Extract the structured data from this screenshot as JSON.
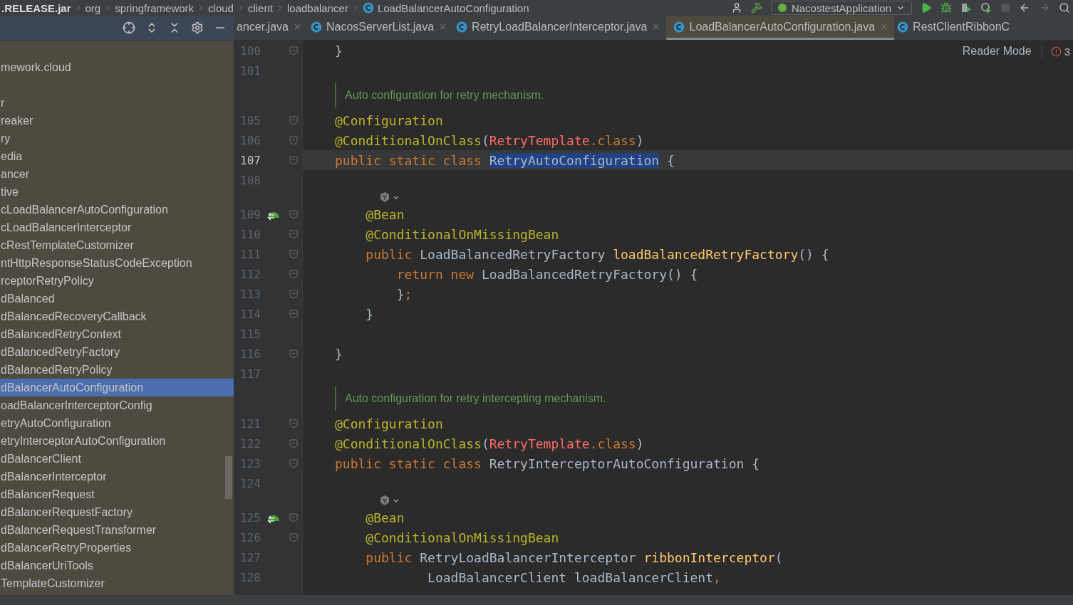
{
  "breadcrumb": [
    {
      "text": ".RELEASE.jar",
      "class_icon": false
    },
    {
      "text": "org",
      "class_icon": false
    },
    {
      "text": "springframework",
      "class_icon": false
    },
    {
      "text": "cloud",
      "class_icon": false
    },
    {
      "text": "client",
      "class_icon": false
    },
    {
      "text": "loadbalancer",
      "class_icon": false
    },
    {
      "text": "LoadBalancerAutoConfiguration",
      "class_icon": true
    }
  ],
  "toolbar": {
    "run_config": "NacostestApplication"
  },
  "project_panel": {
    "items": [
      {
        "text": "mework.cloud",
        "selected": false
      },
      {
        "text": "r",
        "selected": false
      },
      {
        "text": "reaker",
        "selected": false
      },
      {
        "text": "ry",
        "selected": false
      },
      {
        "text": "edia",
        "selected": false
      },
      {
        "text": "ancer",
        "selected": false
      },
      {
        "text": "tive",
        "selected": false
      },
      {
        "text": "cLoadBalancerAutoConfiguration",
        "selected": false
      },
      {
        "text": "cLoadBalancerInterceptor",
        "selected": false
      },
      {
        "text": "cRestTemplateCustomizer",
        "selected": false
      },
      {
        "text": "ntHttpResponseStatusCodeException",
        "selected": false
      },
      {
        "text": "rceptorRetryPolicy",
        "selected": false
      },
      {
        "text": "dBalanced",
        "selected": false
      },
      {
        "text": "dBalancedRecoveryCallback",
        "selected": false
      },
      {
        "text": "dBalancedRetryContext",
        "selected": false
      },
      {
        "text": "dBalancedRetryFactory",
        "selected": false
      },
      {
        "text": "dBalancedRetryPolicy",
        "selected": false
      },
      {
        "text": "dBalancerAutoConfiguration",
        "selected": true
      },
      {
        "text": "oadBalancerInterceptorConfig",
        "selected": false
      },
      {
        "text": "etryAutoConfiguration",
        "selected": false
      },
      {
        "text": "etryInterceptorAutoConfiguration",
        "selected": false
      },
      {
        "text": "dBalancerClient",
        "selected": false
      },
      {
        "text": "dBalancerInterceptor",
        "selected": false
      },
      {
        "text": "dBalancerRequest",
        "selected": false
      },
      {
        "text": "dBalancerRequestFactory",
        "selected": false
      },
      {
        "text": "dBalancerRequestTransformer",
        "selected": false
      },
      {
        "text": "dBalancerRetryProperties",
        "selected": false
      },
      {
        "text": "dBalancerUriTools",
        "selected": false
      },
      {
        "text": "TemplateCustomizer",
        "selected": false
      }
    ]
  },
  "tabs": [
    {
      "label": "ancer.java",
      "class_icon": false,
      "close_button": true,
      "selected": false
    },
    {
      "label": "NacosServerList.java",
      "class_icon": true,
      "close_button": true,
      "selected": false
    },
    {
      "label": "RetryLoadBalancerInterceptor.java",
      "class_icon": true,
      "close_button": true,
      "selected": false
    },
    {
      "label": "LoadBalancerAutoConfiguration.java",
      "class_icon": true,
      "close_button": true,
      "selected": true
    },
    {
      "label": "RestClientRibbonC",
      "class_icon": true,
      "close_button": false,
      "selected": false
    }
  ],
  "editor": {
    "reader_mode": "Reader Mode",
    "error_count": "3",
    "lines": [
      {
        "kind": "code",
        "number": "100",
        "fold": true,
        "bean": false,
        "current": false,
        "tokens": [
          {
            "kind": "plain",
            "text": "}"
          }
        ]
      },
      {
        "kind": "code",
        "number": "101",
        "fold": false,
        "bean": false,
        "current": false
      },
      {
        "kind": "doc",
        "text": "Auto configuration for retry mechanism."
      },
      {
        "kind": "code",
        "number": "105",
        "fold": true,
        "bean": false,
        "current": false,
        "tokens": [
          {
            "kind": "annotation",
            "text": "@Configuration"
          }
        ]
      },
      {
        "kind": "code",
        "number": "106",
        "fold": true,
        "bean": false,
        "current": false,
        "tokens": [
          {
            "kind": "annotation",
            "text": "@ConditionalOnClass"
          },
          {
            "kind": "plain",
            "text": "("
          },
          {
            "kind": "error",
            "text": "RetryTemplate"
          },
          {
            "kind": "keyword",
            "text": ".class"
          },
          {
            "kind": "plain",
            "text": ")"
          }
        ]
      },
      {
        "kind": "code",
        "number": "107",
        "fold": true,
        "bean": false,
        "current": true,
        "tokens": [
          {
            "kind": "keyword",
            "text": "public static class "
          },
          {
            "kind": "selection",
            "text": "RetryAutoConfiguration"
          },
          {
            "kind": "plain",
            "text": " {"
          }
        ]
      },
      {
        "kind": "code",
        "number": "108",
        "fold": false,
        "bean": false,
        "current": false
      },
      {
        "kind": "hint"
      },
      {
        "kind": "code",
        "number": "109",
        "fold": true,
        "bean": true,
        "current": false,
        "tokens": [
          {
            "kind": "annotation",
            "text": "    @Bean"
          }
        ]
      },
      {
        "kind": "code",
        "number": "110",
        "fold": true,
        "bean": false,
        "current": false,
        "tokens": [
          {
            "kind": "annotation",
            "text": "    @ConditionalOnMissingBean"
          }
        ]
      },
      {
        "kind": "code",
        "number": "111",
        "fold": true,
        "bean": false,
        "current": false,
        "tokens": [
          {
            "kind": "keyword",
            "text": "    public "
          },
          {
            "kind": "plain",
            "text": "LoadBalancedRetryFactory "
          },
          {
            "kind": "method",
            "text": "loadBalancedRetryFactory"
          },
          {
            "kind": "plain",
            "text": "() {"
          }
        ]
      },
      {
        "kind": "code",
        "number": "112",
        "fold": true,
        "bean": false,
        "current": false,
        "tokens": [
          {
            "kind": "keyword",
            "text": "        return new "
          },
          {
            "kind": "plain",
            "text": "LoadBalancedRetryFactory() {"
          }
        ]
      },
      {
        "kind": "code",
        "number": "113",
        "fold": true,
        "bean": false,
        "current": false,
        "tokens": [
          {
            "kind": "plain",
            "text": "        }"
          },
          {
            "kind": "keyword",
            "text": ";"
          }
        ]
      },
      {
        "kind": "code",
        "number": "114",
        "fold": true,
        "bean": false,
        "current": false,
        "tokens": [
          {
            "kind": "plain",
            "text": "    }"
          }
        ]
      },
      {
        "kind": "code",
        "number": "115",
        "fold": false,
        "bean": false,
        "current": false
      },
      {
        "kind": "code",
        "number": "116",
        "fold": true,
        "bean": false,
        "current": false,
        "tokens": [
          {
            "kind": "plain",
            "text": "}"
          }
        ]
      },
      {
        "kind": "code",
        "number": "117",
        "fold": false,
        "bean": false,
        "current": false
      },
      {
        "kind": "doc",
        "text": "Auto configuration for retry intercepting mechanism."
      },
      {
        "kind": "code",
        "number": "121",
        "fold": true,
        "bean": false,
        "current": false,
        "tokens": [
          {
            "kind": "annotation",
            "text": "@Configuration"
          }
        ]
      },
      {
        "kind": "code",
        "number": "122",
        "fold": true,
        "bean": false,
        "current": false,
        "tokens": [
          {
            "kind": "annotation",
            "text": "@ConditionalOnClass"
          },
          {
            "kind": "plain",
            "text": "("
          },
          {
            "kind": "error",
            "text": "RetryTemplate"
          },
          {
            "kind": "keyword",
            "text": ".class"
          },
          {
            "kind": "plain",
            "text": ")"
          }
        ]
      },
      {
        "kind": "code",
        "number": "123",
        "fold": true,
        "bean": false,
        "current": false,
        "tokens": [
          {
            "kind": "keyword",
            "text": "public static class "
          },
          {
            "kind": "plain",
            "text": "RetryInterceptorAutoConfiguration {"
          }
        ]
      },
      {
        "kind": "code",
        "number": "124",
        "fold": false,
        "bean": false,
        "current": false
      },
      {
        "kind": "hint"
      },
      {
        "kind": "code",
        "number": "125",
        "fold": true,
        "bean": true,
        "current": false,
        "tokens": [
          {
            "kind": "annotation",
            "text": "    @Bean"
          }
        ]
      },
      {
        "kind": "code",
        "number": "126",
        "fold": true,
        "bean": false,
        "current": false,
        "tokens": [
          {
            "kind": "annotation",
            "text": "    @ConditionalOnMissingBean"
          }
        ]
      },
      {
        "kind": "code",
        "number": "127",
        "fold": false,
        "bean": false,
        "current": false,
        "tokens": [
          {
            "kind": "keyword",
            "text": "    public "
          },
          {
            "kind": "plain",
            "text": "RetryLoadBalancerInterceptor "
          },
          {
            "kind": "method",
            "text": "ribbonInterceptor"
          },
          {
            "kind": "plain",
            "text": "("
          }
        ]
      },
      {
        "kind": "code",
        "number": "128",
        "fold": false,
        "bean": false,
        "current": false,
        "tokens": [
          {
            "kind": "plain",
            "text": "            LoadBalancerClient loadBalancerClient"
          },
          {
            "kind": "keyword",
            "text": ","
          }
        ]
      }
    ]
  }
}
